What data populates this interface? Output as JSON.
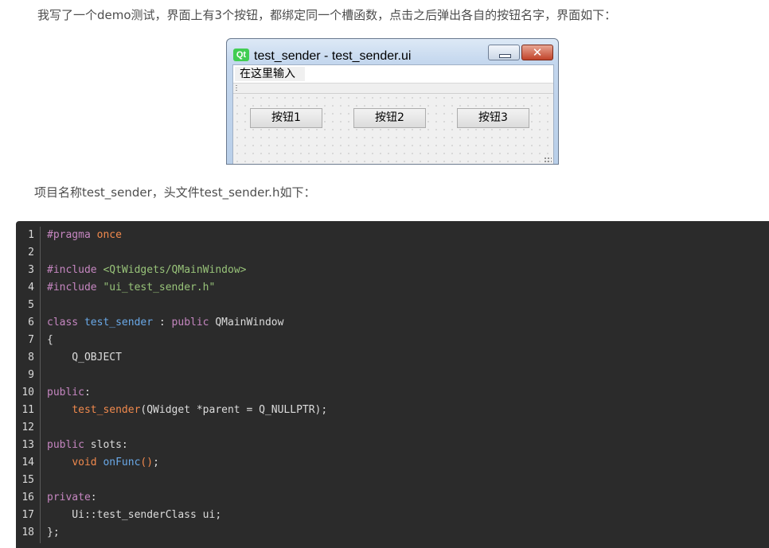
{
  "intro_text": "我写了一个demo测试，界面上有3个按钮，都绑定同一个槽函数，点击之后弹出各自的按钮名字，界面如下：",
  "window": {
    "logo": "Qt",
    "title": "test_sender - test_sender.ui",
    "close_glyph": "✕",
    "menu_input": "在这里输入",
    "buttons": [
      "按钮1",
      "按钮2",
      "按钮3"
    ]
  },
  "project_text": "项目名称test_sender，头文件test_sender.h如下：",
  "code": {
    "line_numbers": [
      "1",
      "2",
      "3",
      "4",
      "5",
      "6",
      "7",
      "8",
      "9",
      "10",
      "11",
      "12",
      "13",
      "14",
      "15",
      "16",
      "17",
      "18"
    ],
    "lines": {
      "l1": [
        "#pragma",
        " ",
        "once"
      ],
      "l3": [
        "#include",
        " ",
        "<QtWidgets/QMainWindow>"
      ],
      "l4": [
        "#include",
        " ",
        "\"ui_test_sender.h\""
      ],
      "l6": [
        "class",
        " ",
        "test_sender",
        " : ",
        "public",
        " QMainWindow"
      ],
      "l7": [
        "{"
      ],
      "l8": [
        "    Q_OBJECT"
      ],
      "l10": [
        "public",
        ":"
      ],
      "l11": [
        "    ",
        "test_sender",
        "(QWidget *parent = Q_NULLPTR);"
      ],
      "l13": [
        "public",
        " slots:"
      ],
      "l14": [
        "    ",
        "void",
        " ",
        "onFunc",
        "()",
        ";"
      ],
      "l16": [
        "private",
        ":"
      ],
      "l17": [
        "    Ui::test_senderClass ui;"
      ],
      "l18": [
        "};"
      ]
    }
  },
  "colors": {
    "code_bg": "#2b2b2b",
    "keyword": "#c586c0",
    "string": "#98c379",
    "function": "#6aa9e8",
    "orange": "#f0894d",
    "qt_green": "#41cd52"
  }
}
